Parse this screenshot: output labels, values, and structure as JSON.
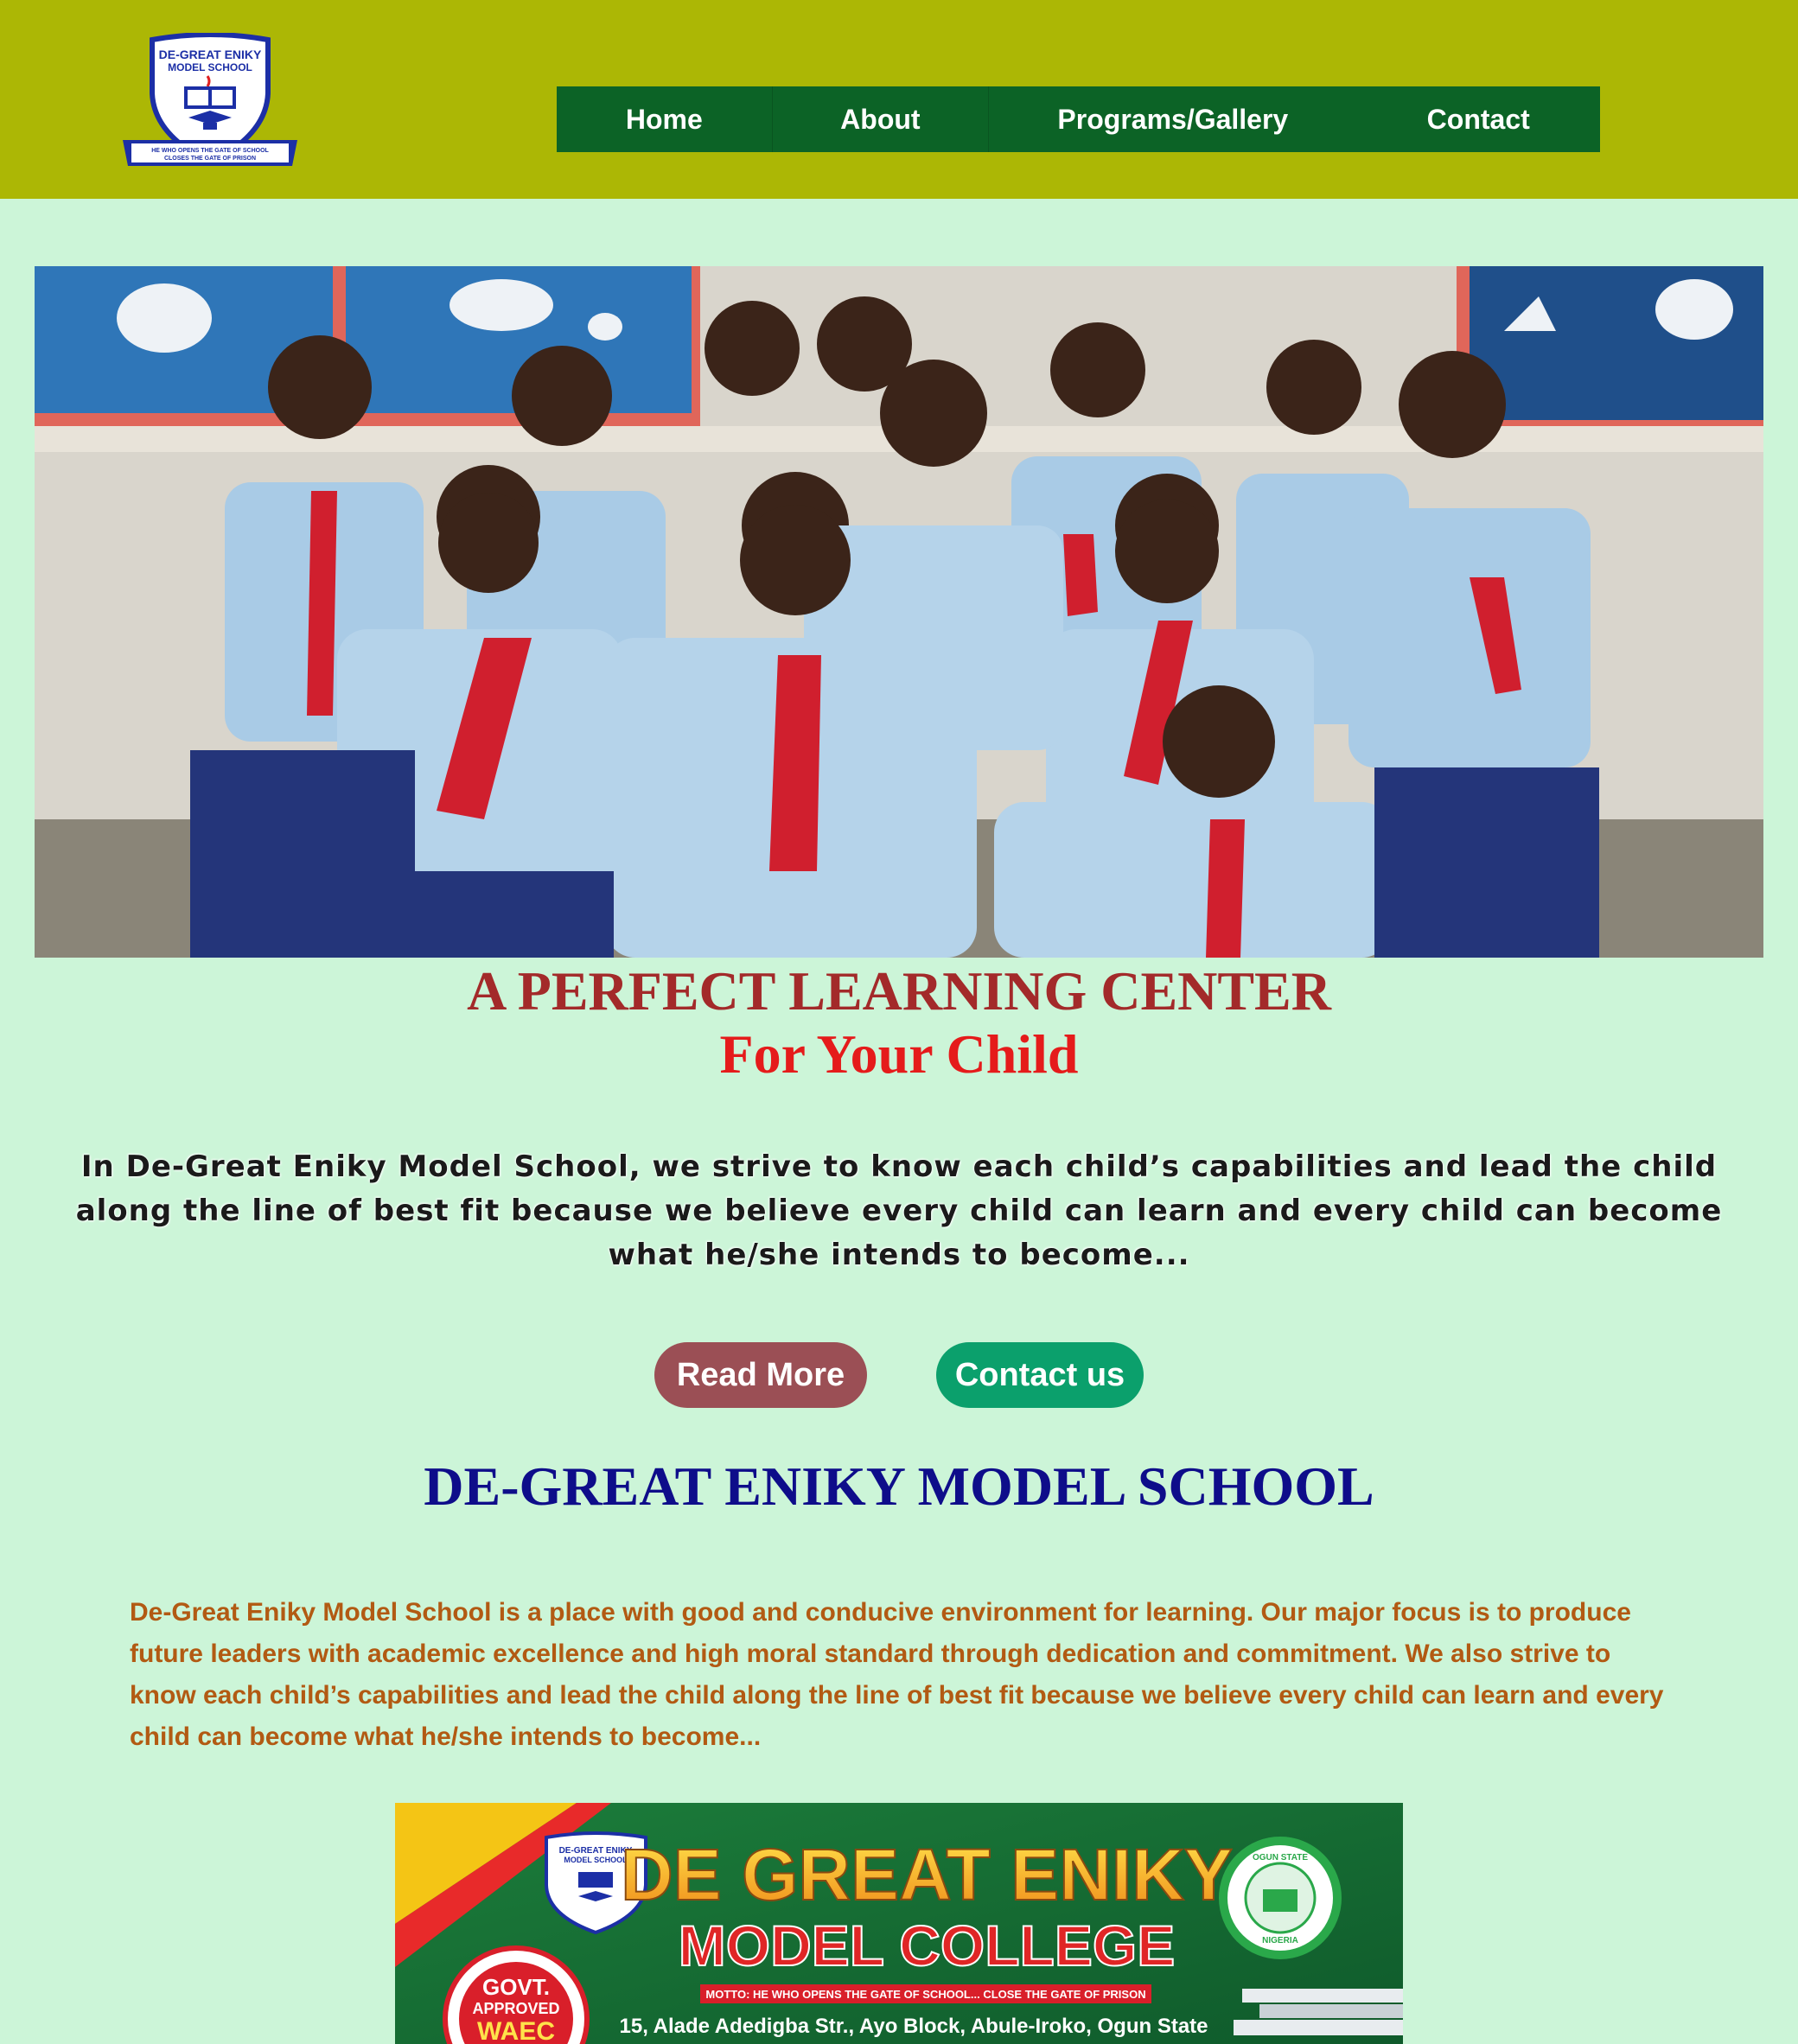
{
  "header": {
    "logo": {
      "name_line1": "DE-GREAT ENIKY",
      "name_line2": "MODEL SCHOOL",
      "motto_line1": "HE WHO OPENS THE GATE OF SCHOOL",
      "motto_line2": "CLOSES THE GATE OF PRISON",
      "icon": "school-crest-icon"
    },
    "nav": {
      "home": "Home",
      "about": "About",
      "programs": "Programs/Gallery",
      "contact": "Contact"
    }
  },
  "hero": {
    "image_icon": "students-group-photo",
    "headline_line1": "A PERFECT LEARNING CENTER",
    "headline_line2": "For Your Child",
    "intro": "In De-Great Eniky Model School, we strive to know each child’s capabilities and lead the child along the line of best fit because we believe every child can learn and every child can become what he/she intends to become...",
    "read_more": "Read More",
    "contact_us": "Contact us"
  },
  "about": {
    "title": "DE-GREAT ENIKY MODEL SCHOOL",
    "text": "De-Great Eniky Model School is a place with good and conducive environment for learning. Our major focus is to produce future leaders with academic excellence and high moral standard through dedication and commitment. We also strive to know each child’s capabilities and lead the child along the line of best fit because we believe every child can learn and every child can become what he/she intends to become..."
  },
  "banner": {
    "title_line1": "DE GREAT ENIKY",
    "title_line2": "MODEL COLLEGE",
    "motto": "MOTTO: HE WHO OPENS THE GATE OF SCHOOL... CLOSE THE GATE OF PRISON",
    "address": "15, Alade Adedigba Str., Ayo Block, Abule-Iroko, Ogun State",
    "badge_line1": "GOVT.",
    "badge_line2": "APPROVED",
    "badge_line3": "WAEC",
    "seal_top": "OGUN STATE",
    "seal_bottom": "NIGERIA",
    "crest_line1": "DE-GREAT ENIKY",
    "crest_line2": "MODEL SCHOOL"
  },
  "colors": {
    "topbar": "#acb705",
    "nav": "#0c6326",
    "page_bg": "#ccf5d8",
    "headline": "#a32a2a",
    "headline_accent": "#e51b1b",
    "read_more_btn": "#9b4f55",
    "contact_btn": "#0ba06c",
    "school_title": "#0e0d8a",
    "about_text": "#b25a13"
  }
}
